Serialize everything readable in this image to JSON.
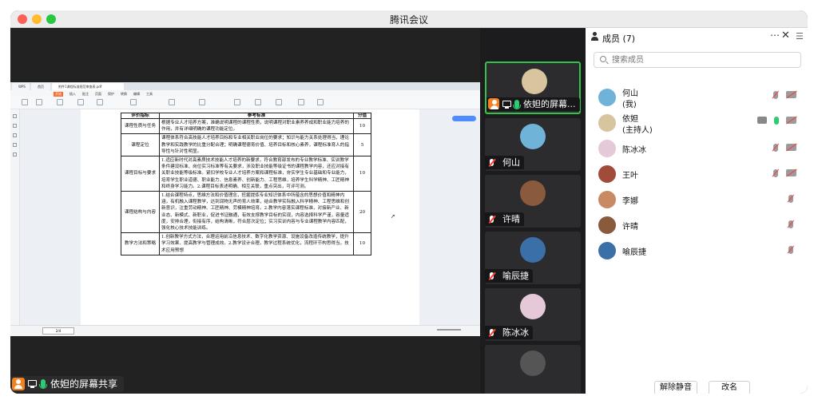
{
  "app": {
    "title": "腾讯会议"
  },
  "share": {
    "label": "依妲的屏幕共享"
  },
  "wps": {
    "tabs": [
      "WPS",
      "首页",
      "附件1课程标准规范审查表.pdf"
    ],
    "menu": [
      "开始",
      "插入",
      "批注",
      "页面",
      "保护",
      "转换",
      "编辑",
      "工具"
    ],
    "page_indicator": "2/4"
  },
  "doc": {
    "header": [
      "评价指标",
      "参考标准",
      "分值"
    ],
    "rows": [
      {
        "indicator": "课程性质与任务",
        "standard": "根据专业人才培养方案，准确说明课程的课程性质，说明课程对职业素养养成和职业能力培养的作用，并有详细明确的课程功能定位。",
        "score": "10"
      },
      {
        "indicator": "课程定位",
        "standard": "课程体系符合高技能人才培养目标和专业相关职业岗位的要求；知识与能力关系处理得当，理论教学和实践教学的比重分配合理；明确课程德育价值、培养目标和核心素养，课程标准育人的指导性与针对性明显。",
        "score": "5"
      },
      {
        "indicator": "课程目标与要求",
        "standard": "1.适应新时代对高素质技术技能人才培养的新要求，符合教育部发布的专业教学标准、实训教学条件建设标准、岗位实习标准等有关要求，涉及职业技能等级证书的课程教学内容，还应对接有关职业技能等级标准。紧扣学校专业人才培养方案和课程标准，夯实学生专业基础和专业能力，培育学生职业道德、职业能力、信息素养、创新能力、工程思维，培养学生科学精神、工匠精神和终身学习能力。2.课程目标表述明确、相互关联，重点突出，可评可测。",
        "score": "10"
      },
      {
        "indicator": "课程结构与内容",
        "standard": "1.结合课程特点，思维方法和价值理念，挖掘提炼专业知识体系中所蕴含的思想价值和精神内涵，有机融入课程教学，达到润物无声的育人效果，结合教学实际融入科学精神、工程思维和创新意识，注重劳动精神、工匠精神、劳模精神培育。2.教学内容落实课程标准，对接新产业、新业态、新模式、新职业，促进书证融通，有效支撑教学目标的实现，内容选择科学严谨，容量适度，安排合理，衔接有序，结构清晰，符合层次定位；实习实训内容与专业课程教学内容匹配，强化核心技术技能训练。",
        "score": "20"
      },
      {
        "indicator": "教学方法和策略",
        "standard": "1.创新教学方式方法，合理运用前沿信息技术、数字化教学资源、设施设备改造传统教学，提升学习效果、提高教学与管理成效。2.教学设计合理，教学过程系统优化，流程环节构思得当，技术应用预想",
        "score": "10"
      }
    ]
  },
  "tiles": [
    {
      "label": "依妲的屏幕...",
      "color": "#d9c4a0",
      "active": true
    },
    {
      "label": "何山",
      "color": "#6fb4d8"
    },
    {
      "label": "许晴",
      "color": "#8a5a3c"
    },
    {
      "label": "喻辰捷",
      "color": "#3a6fa8"
    },
    {
      "label": "陈冰冰",
      "color": "#e6c9d8"
    },
    {
      "label": "",
      "color": "#555"
    }
  ],
  "panel": {
    "title": "成员 (7)",
    "search_placeholder": "搜索成员",
    "members": [
      {
        "name": "何山",
        "sub": "(我)",
        "color": "#6fb4d8"
      },
      {
        "name": "依妲",
        "sub": "(主持人)",
        "color": "#d9c4a0"
      },
      {
        "name": "陈冰冰",
        "sub": "",
        "color": "#e6c9d8"
      },
      {
        "name": "王叶",
        "sub": "",
        "color": "#a14b3a"
      },
      {
        "name": "李娜",
        "sub": "",
        "color": "#c98a63"
      },
      {
        "name": "许晴",
        "sub": "",
        "color": "#8a5a3c"
      },
      {
        "name": "喻辰捷",
        "sub": "",
        "color": "#3a6fa8"
      }
    ],
    "unmute_label": "解除静音",
    "rename_label": "改名"
  }
}
